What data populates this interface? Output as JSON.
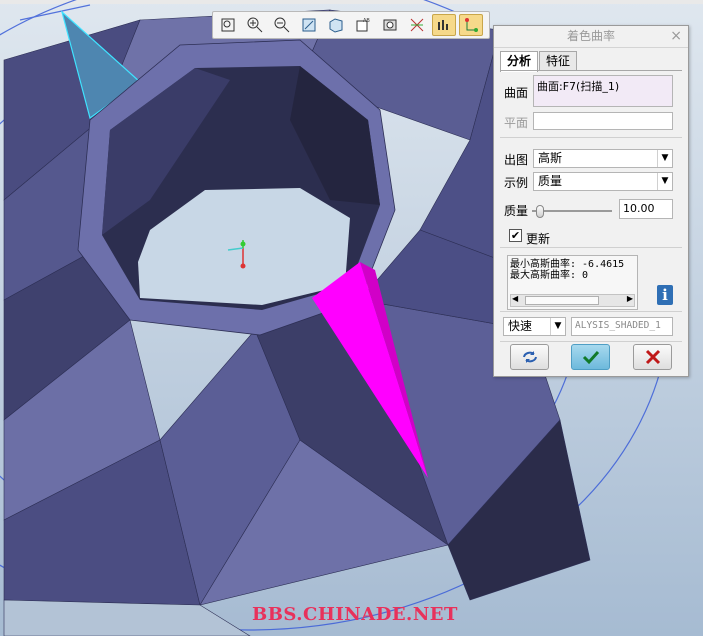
{
  "toolbar": {
    "buttons": [
      "zoom-fit-icon",
      "zoom-in-icon",
      "zoom-out-icon",
      "repaint-icon",
      "shading-icon",
      "view-manager-icon",
      "saved-view-icon",
      "datum-display-icon",
      "analysis-display-icon",
      "spin-center-icon"
    ]
  },
  "dialog": {
    "title": "着色曲率",
    "close": "×",
    "tabs": [
      "分析",
      "特征"
    ],
    "surface_label": "曲面",
    "surface_value": "曲面:F7(扫描_1)",
    "plane_label": "平面",
    "plot_label": "出图",
    "plot_value": "高斯",
    "example_label": "示例",
    "example_value": "质量",
    "quality_label": "质量",
    "quality_value": "10.00",
    "quality_slider": 0.05,
    "update_label": "更新",
    "update_checked": true,
    "min_gauss": "最小高斯曲率: -6.4615",
    "max_gauss": "最大高斯曲率: 0",
    "speed_value": "快速",
    "analysis_name": "ALYSIS_SHADED_1"
  },
  "colors": {
    "model": "#5d5f95",
    "highlight": "#ff00ff",
    "background": "#b5c7da",
    "accent": "#2f7fb5"
  },
  "watermark": "BBS.CHINADE.NET"
}
